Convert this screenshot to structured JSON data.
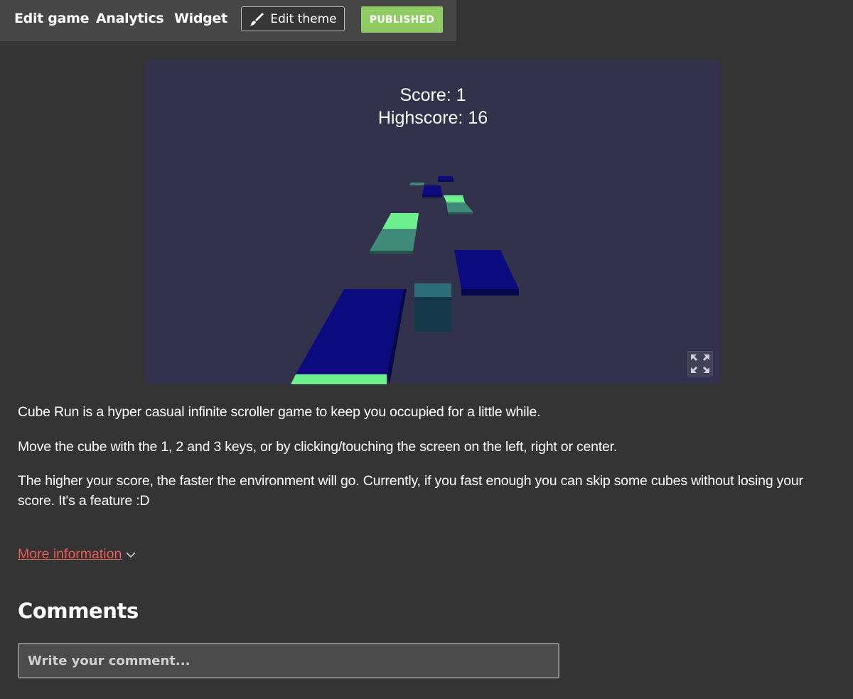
{
  "nav": {
    "edit_game": "Edit game",
    "analytics": "Analytics",
    "widget": "Widget",
    "edit_theme": "Edit theme",
    "edit_theme_icon": "paintbrush-icon",
    "published": "PUBLISHED"
  },
  "game": {
    "score": "Score: 1",
    "highscore": "Highscore: 16",
    "fullscreen_icon": "fullscreen-icon",
    "background_color": "#33324c"
  },
  "description": {
    "paragraph_1": "Cube Run is a hyper casual infinite scroller game to keep you occupied for a little while.",
    "paragraph_2": "Move the cube with the 1, 2 and 3 keys, or by clicking/touching the screen on the left, right or center.",
    "paragraph_3": "The higher your score, the faster the environment will go. Currently, if you fast enough you can skip some cubes without losing your score. It's a feature :D"
  },
  "more_info": {
    "label": "More information",
    "icon": "chevron-down-icon"
  },
  "comments": {
    "heading": "Comments",
    "placeholder": "Write your comment..."
  },
  "colors": {
    "page_background": "#343434",
    "topbar_background": "#474747",
    "published_green": "#8fcc64",
    "link_red": "#e65d56",
    "tile_blue": "#0c0b7f",
    "tile_green": "#6df08e",
    "tile_teal": "#3f8a79"
  }
}
